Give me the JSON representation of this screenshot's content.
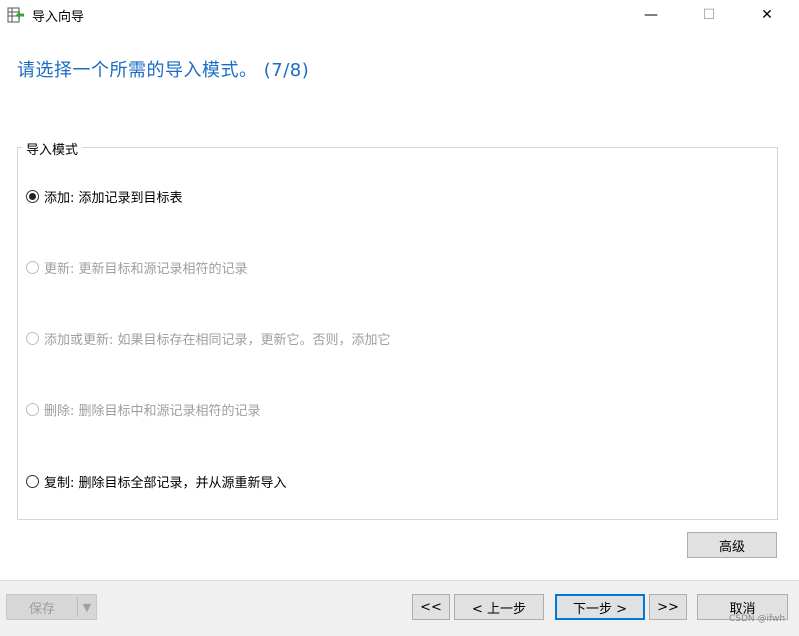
{
  "window": {
    "title": "导入向导",
    "minimize_glyph": "—",
    "maximize_glyph": "☐",
    "close_glyph": "✕"
  },
  "heading": "请选择一个所需的导入模式。 (7/8)",
  "group": {
    "legend": "导入模式",
    "options": [
      {
        "label": "添加: 添加记录到目标表",
        "checked": true,
        "enabled": true
      },
      {
        "label": "更新: 更新目标和源记录相符的记录",
        "checked": false,
        "enabled": false
      },
      {
        "label": "添加或更新: 如果目标存在相同记录，更新它。否则，添加它",
        "checked": false,
        "enabled": false
      },
      {
        "label": "删除: 删除目标中和源记录相符的记录",
        "checked": false,
        "enabled": false
      },
      {
        "label": "复制: 删除目标全部记录，并从源重新导入",
        "checked": false,
        "enabled": true
      }
    ]
  },
  "advanced_label": "高级",
  "footer": {
    "save_label": "保存",
    "first_label": "<<",
    "prev_label": "< 上一步",
    "next_label": "下一步 >",
    "last_label": ">>",
    "cancel_label": "取消"
  },
  "watermark": "CSDN @ifwh",
  "colors": {
    "heading": "#1a6cc4",
    "primary_border": "#0078d7"
  }
}
